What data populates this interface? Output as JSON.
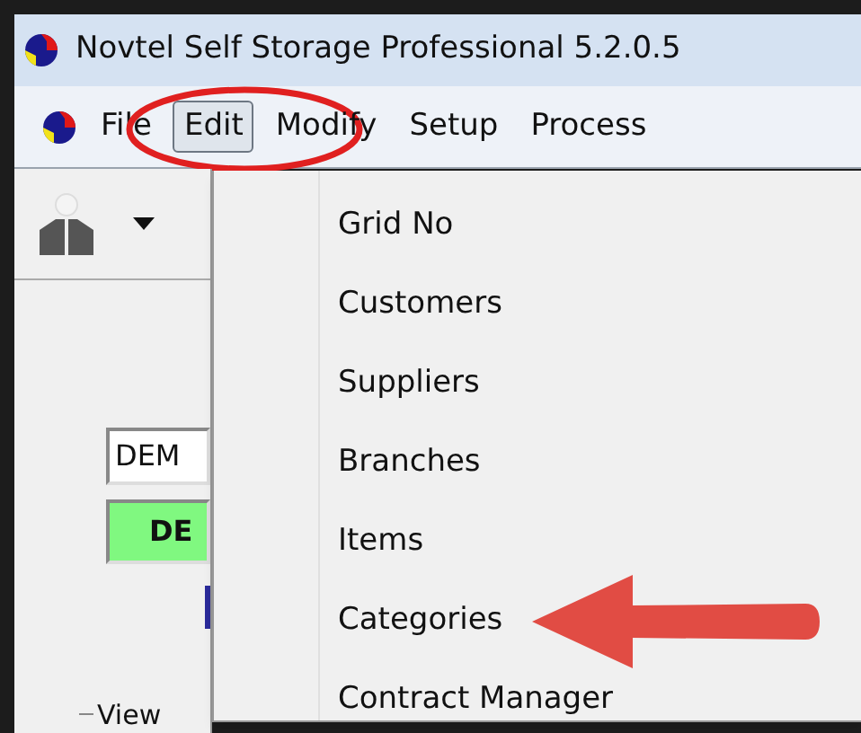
{
  "window": {
    "title": "Novtel Self Storage Professional 5.2.0.5"
  },
  "menu_bar": [
    {
      "label": "File",
      "selected": false,
      "circled": false
    },
    {
      "label": "Edit",
      "selected": true,
      "circled": true
    },
    {
      "label": "Modify",
      "selected": false,
      "circled": false
    },
    {
      "label": "Setup",
      "selected": false,
      "circled": false
    },
    {
      "label": "Process",
      "selected": false,
      "circled": false
    }
  ],
  "left_panel": {
    "code_field": {
      "value": "DEM"
    },
    "status_button": "DE",
    "group_label": "View"
  },
  "dropdown": {
    "items": [
      {
        "label": "Grid No",
        "pointed": false
      },
      {
        "label": "Customers",
        "pointed": false
      },
      {
        "label": "Suppliers",
        "pointed": false
      },
      {
        "label": "Branches",
        "pointed": false
      },
      {
        "label": "Items",
        "pointed": false
      },
      {
        "label": "Categories",
        "pointed": true
      },
      {
        "label": "Contract Manager",
        "pointed": false
      }
    ]
  }
}
